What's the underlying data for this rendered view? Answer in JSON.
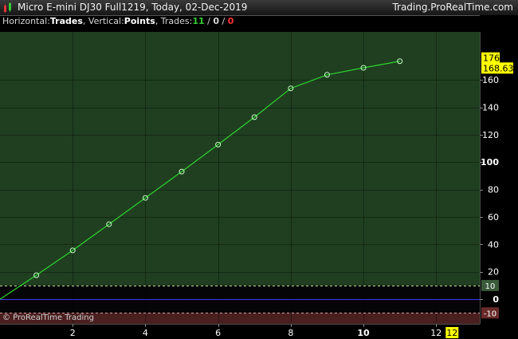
{
  "window": {
    "title": "Micro E-mini DJ30 Full1219, Today, 02-Dec-2019",
    "site": "Trading.ProRealTime.com"
  },
  "info_bar": {
    "horizontal_label": "Horizontal:",
    "horizontal_value": "Trades",
    "vertical_label": ", Vertical:",
    "vertical_value": "Points",
    "trades_label": ", Trades:",
    "trades_winning": "11",
    "trades_sep1": " / ",
    "trades_neutral": "0",
    "trades_sep2": " / ",
    "trades_losing": "0"
  },
  "watermark": "© ProRealTime Trading",
  "colors": {
    "positive_zone": "#1f3f20",
    "negative_zone": "#4a1f1f",
    "neutral_zone": "#050508",
    "line": "#2ed42e",
    "zero_line": "#3a3aff",
    "badge_yellow": "#ffff00",
    "trades_winning": "#33cc33",
    "trades_losing": "#ff3333"
  },
  "chart_data": {
    "type": "line",
    "x": [
      0,
      1,
      2,
      3,
      4,
      5,
      6,
      7,
      8,
      9,
      10,
      11
    ],
    "y": [
      0,
      17.5,
      35.6,
      54.7,
      73.9,
      93.1,
      112.8,
      132.8,
      153.8,
      163.7,
      168.8,
      173.6
    ],
    "markers_from_index": 1,
    "xlim": [
      0,
      13.2
    ],
    "ylim": [
      -18,
      195
    ],
    "x_ticks": [
      {
        "value": 2,
        "label": "2",
        "bold": false
      },
      {
        "value": 4,
        "label": "4",
        "bold": false
      },
      {
        "value": 6,
        "label": "6",
        "bold": false
      },
      {
        "value": 8,
        "label": "8",
        "bold": false
      },
      {
        "value": 10,
        "label": "10",
        "bold": true
      },
      {
        "value": 12,
        "label": "12",
        "bold": false,
        "highlight": true
      }
    ],
    "y_ticks": [
      {
        "value": 0,
        "label": "0",
        "bold": true
      },
      {
        "value": 20,
        "label": "20",
        "bold": false
      },
      {
        "value": 40,
        "label": "40",
        "bold": false
      },
      {
        "value": 60,
        "label": "60",
        "bold": false
      },
      {
        "value": 80,
        "label": "80",
        "bold": false
      },
      {
        "value": 100,
        "label": "100",
        "bold": true
      },
      {
        "value": 120,
        "label": "120",
        "bold": false
      },
      {
        "value": 140,
        "label": "140",
        "bold": false
      },
      {
        "value": 160,
        "label": "160",
        "bold": false
      }
    ],
    "reference_lines": [
      {
        "value": 10,
        "label": "10",
        "kind": "upper"
      },
      {
        "value": -10,
        "label": "-10",
        "kind": "lower"
      }
    ],
    "value_badges": [
      {
        "value": 176,
        "label": "176"
      },
      {
        "value": 168.63,
        "label": "168.63"
      }
    ],
    "grid": true
  }
}
